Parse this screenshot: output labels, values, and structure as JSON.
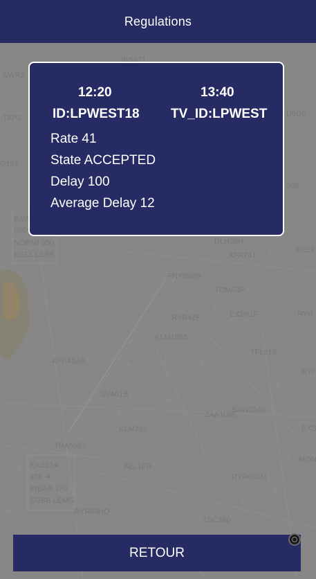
{
  "header": {
    "title": "Regulations"
  },
  "card": {
    "time_start": "12:20",
    "time_end": "13:40",
    "id": "ID:LPWEST18",
    "tv_id": "TV_ID:LPWEST",
    "rate": "Rate 41",
    "state": "State ACCEPTED",
    "delay": "Delay 100",
    "average_delay": "Average Delay 12"
  },
  "footer": {
    "retour_label": "RETOUR"
  },
  "map": {
    "labels": [
      "BAW",
      "350",
      "NORMI 350",
      "EGLL LEBB",
      "AFR48AK",
      "SVA01B",
      "KLM792",
      "BEL1FR",
      "TRA5957",
      "EXS23A",
      "370 ➜",
      "INBAB 370",
      "EGBB LEMG",
      "RYR69HQ",
      "FNY55H9",
      "TOM63P",
      "EXS91F",
      "RYR4ZF",
      "KLM1695",
      "TFL616",
      "AFR741",
      "DLH38H",
      "BAW2546",
      "RYR680M",
      "TSC380",
      "ZAA1086",
      "SWR2",
      "TAP3",
      "G151",
      "BEL9",
      "RYR",
      "RYI",
      "EXS",
      "MON",
      "206",
      "U6DE",
      "IBS671"
    ]
  }
}
